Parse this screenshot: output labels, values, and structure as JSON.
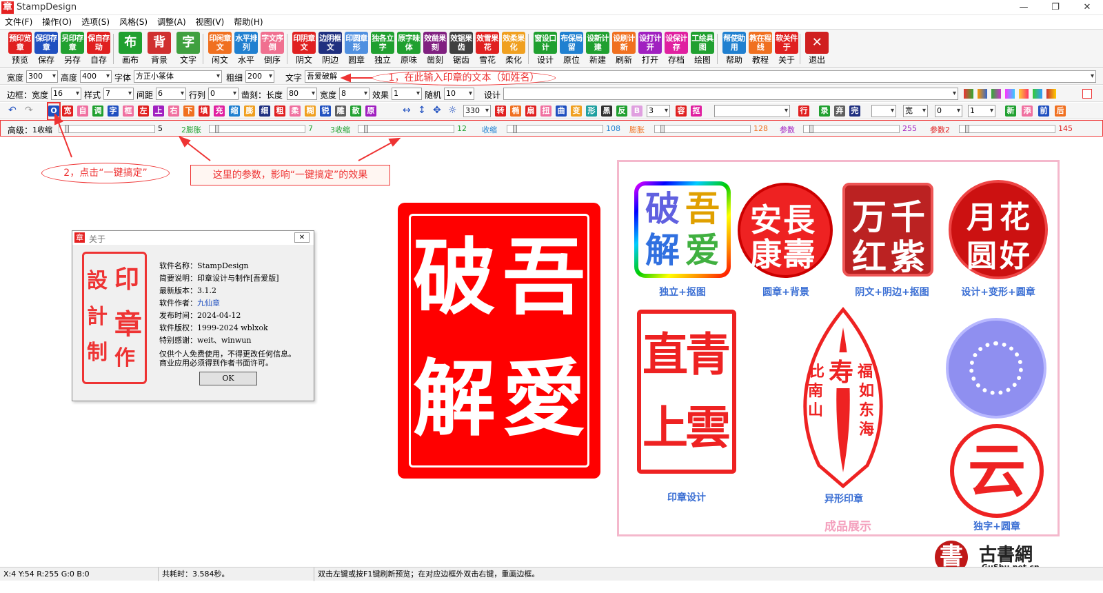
{
  "window": {
    "app_icon": "章",
    "title": "StampDesign"
  },
  "menu": [
    "文件(F)",
    "操作(O)",
    "选项(S)",
    "风格(S)",
    "调整(A)",
    "视图(V)",
    "帮助(H)"
  ],
  "toolbar": [
    {
      "face": "预印览章",
      "cap": "预览",
      "color": "#e02020"
    },
    {
      "face": "保印存章",
      "cap": "保存",
      "color": "#2050c0"
    },
    {
      "face": "另印存章",
      "cap": "另存",
      "color": "#20a030"
    },
    {
      "face": "保自存动",
      "cap": "自存",
      "color": "#e02020"
    },
    {
      "face": "布",
      "cap": "画布",
      "color": "#20a030"
    },
    {
      "face": "背",
      "cap": "背景",
      "color": "#d03030"
    },
    {
      "face": "字",
      "cap": "文字",
      "color": "#40a040"
    },
    {
      "face": "印闲章文",
      "cap": "闲文",
      "color": "#f07020"
    },
    {
      "face": "水平排列",
      "cap": "水平",
      "color": "#2080d0"
    },
    {
      "face": "字文序倒",
      "cap": "倒序",
      "color": "#f07090"
    },
    {
      "face": "印阴章文",
      "cap": "阴文",
      "color": "#e02020"
    },
    {
      "face": "边阴框文",
      "cap": "阴边",
      "color": "#203080"
    },
    {
      "face": "印圆章形",
      "cap": "圆章",
      "color": "#5090e0"
    },
    {
      "face": "独各立字",
      "cap": "独立",
      "color": "#20a030"
    },
    {
      "face": "原字味体",
      "cap": "原味",
      "color": "#20a030"
    },
    {
      "face": "效凿果刻",
      "cap": "凿刻",
      "color": "#802080"
    },
    {
      "face": "效锯果齿",
      "cap": "锯齿",
      "color": "#404040"
    },
    {
      "face": "效雪果花",
      "cap": "雪花",
      "color": "#e02020"
    },
    {
      "face": "效柔果化",
      "cap": "柔化",
      "color": "#f0a020"
    },
    {
      "face": "窗设口计",
      "cap": "设计",
      "color": "#20a030"
    },
    {
      "face": "布保局留",
      "cap": "原位",
      "color": "#2080d0"
    },
    {
      "face": "设新计建",
      "cap": "新建",
      "color": "#20a030"
    },
    {
      "face": "设刷计新",
      "cap": "刷新",
      "color": "#f07020"
    },
    {
      "face": "设打计开",
      "cap": "打开",
      "color": "#a020c0"
    },
    {
      "face": "设保计存",
      "cap": "存档",
      "color": "#e020a0"
    },
    {
      "face": "工绘具图",
      "cap": "绘图",
      "color": "#20a030"
    },
    {
      "face": "帮使助用",
      "cap": "帮助",
      "color": "#2080d0"
    },
    {
      "face": "教在程线",
      "cap": "教程",
      "color": "#f07020"
    },
    {
      "face": "软关件于",
      "cap": "关于",
      "color": "#e02020"
    },
    {
      "face": "✕",
      "cap": "退出",
      "color": "#d02020"
    }
  ],
  "row1": {
    "width_label": "宽度",
    "width": "300",
    "height_label": "高度",
    "height": "400",
    "font_label": "字体",
    "font": "方正小篆体",
    "weight_label": "粗细",
    "weight": "200",
    "text_label": "文字",
    "text": "吾爱破解"
  },
  "row2": {
    "border_label": "边框：宽度",
    "border_width": "16",
    "style_label": "样式",
    "style": "7",
    "gap_label": "间距",
    "gap": "6",
    "linegap_label": "行列",
    "linegap": "0",
    "carve_label": "凿刻：长度",
    "carve_len": "80",
    "carve_width_label": "宽度",
    "carve_width": "8",
    "effect_label": "效果",
    "effect": "1",
    "random_label": "随机",
    "random": "10",
    "design_label": "设计"
  },
  "row3": {
    "buttons": [
      {
        "t": "O",
        "c": "#2050c0"
      },
      {
        "t": "宽",
        "c": "#e02020"
      },
      {
        "t": "自",
        "c": "#f070a0"
      },
      {
        "t": "调",
        "c": "#20a030"
      },
      {
        "t": "字",
        "c": "#2050c0"
      },
      {
        "t": "框",
        "c": "#f070a0"
      },
      {
        "t": "左",
        "c": "#e02020"
      },
      {
        "t": "上",
        "c": "#a020c0"
      },
      {
        "t": "右",
        "c": "#f070a0"
      },
      {
        "t": "下",
        "c": "#f07020"
      },
      {
        "t": "填",
        "c": "#e02020"
      },
      {
        "t": "充",
        "c": "#e020a0"
      },
      {
        "t": "缩",
        "c": "#2080d0"
      },
      {
        "t": "膨",
        "c": "#f0a020"
      },
      {
        "t": "细",
        "c": "#203080"
      },
      {
        "t": "粗",
        "c": "#e02020"
      },
      {
        "t": "柔",
        "c": "#f070a0"
      },
      {
        "t": "糊",
        "c": "#f0a020"
      },
      {
        "t": "锐",
        "c": "#2050c0"
      },
      {
        "t": "雕",
        "c": "#606060"
      },
      {
        "t": "散",
        "c": "#20a030"
      },
      {
        "t": "原",
        "c": "#a020c0"
      }
    ],
    "rotate": "330",
    "buttons2": [
      {
        "t": "转",
        "c": "#e02020"
      },
      {
        "t": "椭",
        "c": "#f07020"
      },
      {
        "t": "扇",
        "c": "#e02020"
      },
      {
        "t": "扭",
        "c": "#f070a0"
      },
      {
        "t": "曲",
        "c": "#2050c0"
      },
      {
        "t": "变",
        "c": "#f0a020"
      },
      {
        "t": "形",
        "c": "#20a0a0"
      },
      {
        "t": "黑",
        "c": "#303030"
      },
      {
        "t": "反",
        "c": "#20a030"
      },
      {
        "t": "B",
        "c": "#e0a0e0"
      }
    ],
    "count": "3",
    "buttons3": [
      {
        "t": "容",
        "c": "#e02020"
      },
      {
        "t": "抠",
        "c": "#e020a0"
      }
    ],
    "row_btn": {
      "t": "行",
      "c": "#e02020"
    },
    "buttons4": [
      {
        "t": "录",
        "c": "#20a030"
      },
      {
        "t": "弃",
        "c": "#606060"
      },
      {
        "t": "完",
        "c": "#203080"
      }
    ],
    "wide": "宽",
    "val_a": "0",
    "val_b": "1",
    "buttons5": [
      {
        "t": "新",
        "c": "#20a030"
      },
      {
        "t": "添",
        "c": "#f070a0"
      },
      {
        "t": "前",
        "c": "#2050c0"
      },
      {
        "t": "后",
        "c": "#f07020"
      }
    ]
  },
  "row4": {
    "advanced": "高级：",
    "sliders": [
      {
        "label": "1收缩",
        "end": "5",
        "color": "#000000"
      },
      {
        "label": "2膨胀",
        "end": "7",
        "color": "#20a030"
      },
      {
        "label": "3收缩",
        "end": "12",
        "color": "#20a030"
      },
      {
        "label": "收缩",
        "end": "108",
        "color": "#2080d0"
      },
      {
        "label": "膨胀",
        "end": "128",
        "color": "#f07020"
      },
      {
        "label": "参数",
        "end": "255",
        "color": "#a020c0"
      },
      {
        "label": "参数2",
        "end": "145",
        "color": "#e02020"
      }
    ]
  },
  "annotations": {
    "step1": "1，在此输入印章的文本（如姓名）",
    "step2": "2，点击“一键搞定”",
    "params": "这里的参数，影响“一键搞定”的效果"
  },
  "about": {
    "icon": "章",
    "title": "关于",
    "seal_chars": [
      "印",
      "章",
      "設",
      "計",
      "制",
      "作"
    ],
    "lines": [
      {
        "k": "软件名称：",
        "v": "StampDesign"
      },
      {
        "k": "简要说明：",
        "v": "印章设计与制作[吾爱版]"
      },
      {
        "k": "最新版本：",
        "v": "3.1.2"
      },
      {
        "k": "软件作者：",
        "v": "九仙章"
      },
      {
        "k": "发布时间：",
        "v": "2024-04-12"
      },
      {
        "k": "软件版权：",
        "v": "1999-2024 wblxok"
      },
      {
        "k": "特别感谢：",
        "v": "weit、winwun"
      }
    ],
    "note1": "仅供个人免费使用，不得更改任何信息。",
    "note2": "商业应用必须得到作者书面许可。",
    "ok": "OK"
  },
  "main_stamp": {
    "chars": [
      "吾",
      "愛",
      "破",
      "解"
    ],
    "color": "#ff0000"
  },
  "showcase": {
    "items": [
      {
        "caption": "独立+抠图",
        "chars": [
          "破",
          "吾",
          "解",
          "爱"
        ]
      },
      {
        "caption": "圆章+背景",
        "chars": [
          "長",
          "壽",
          "安",
          "康"
        ]
      },
      {
        "caption": "阴文+阴边+抠图",
        "chars": [
          "千",
          "万",
          "红",
          "紫"
        ]
      },
      {
        "caption": "设计+变形+圆章",
        "chars": [
          "花",
          "好",
          "月",
          "圆"
        ]
      },
      {
        "caption": "印章设计",
        "chars": [
          "青",
          "雲",
          "直",
          "上"
        ]
      },
      {
        "caption": "异形印章",
        "chars": [
          "寿",
          "比",
          "南",
          "山",
          "福",
          "如",
          "东",
          "海"
        ]
      },
      {
        "caption": "独字+圆章",
        "chars": [
          "云"
        ]
      }
    ],
    "title": "成品展示"
  },
  "watermark": {
    "logo": "書",
    "name": "古書網",
    "url": "GuShu.net.cn"
  },
  "status": {
    "coords": "X:4 Y:54 R:255 G:0 B:0",
    "time": "共耗时：3.584秒。",
    "hint": "双击左键或按F1键刷新预览；在对应边框外双击右键，重画边框。"
  }
}
